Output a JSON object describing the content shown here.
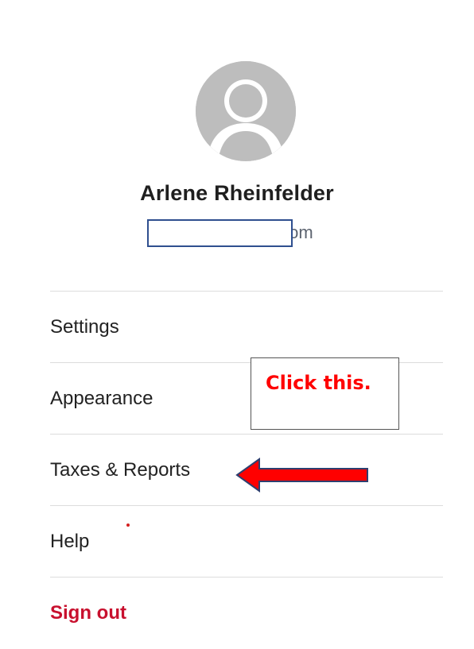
{
  "profile": {
    "name": "Arlene Rheinfelder",
    "email": "arlene                gmail.com",
    "avatar_icon": "user-silhouette-icon"
  },
  "menu": {
    "items": [
      {
        "label": "Settings"
      },
      {
        "label": "Appearance"
      },
      {
        "label": "Taxes & Reports"
      },
      {
        "label": "Help"
      },
      {
        "label": "Sign out"
      }
    ]
  },
  "annotation": {
    "callout_text": "Click this.",
    "arrow_icon": "red-left-arrow-icon"
  },
  "colors": {
    "signout": "#c8102e",
    "annotation_red": "#ff0000",
    "redaction_border": "#2f4f8f"
  }
}
